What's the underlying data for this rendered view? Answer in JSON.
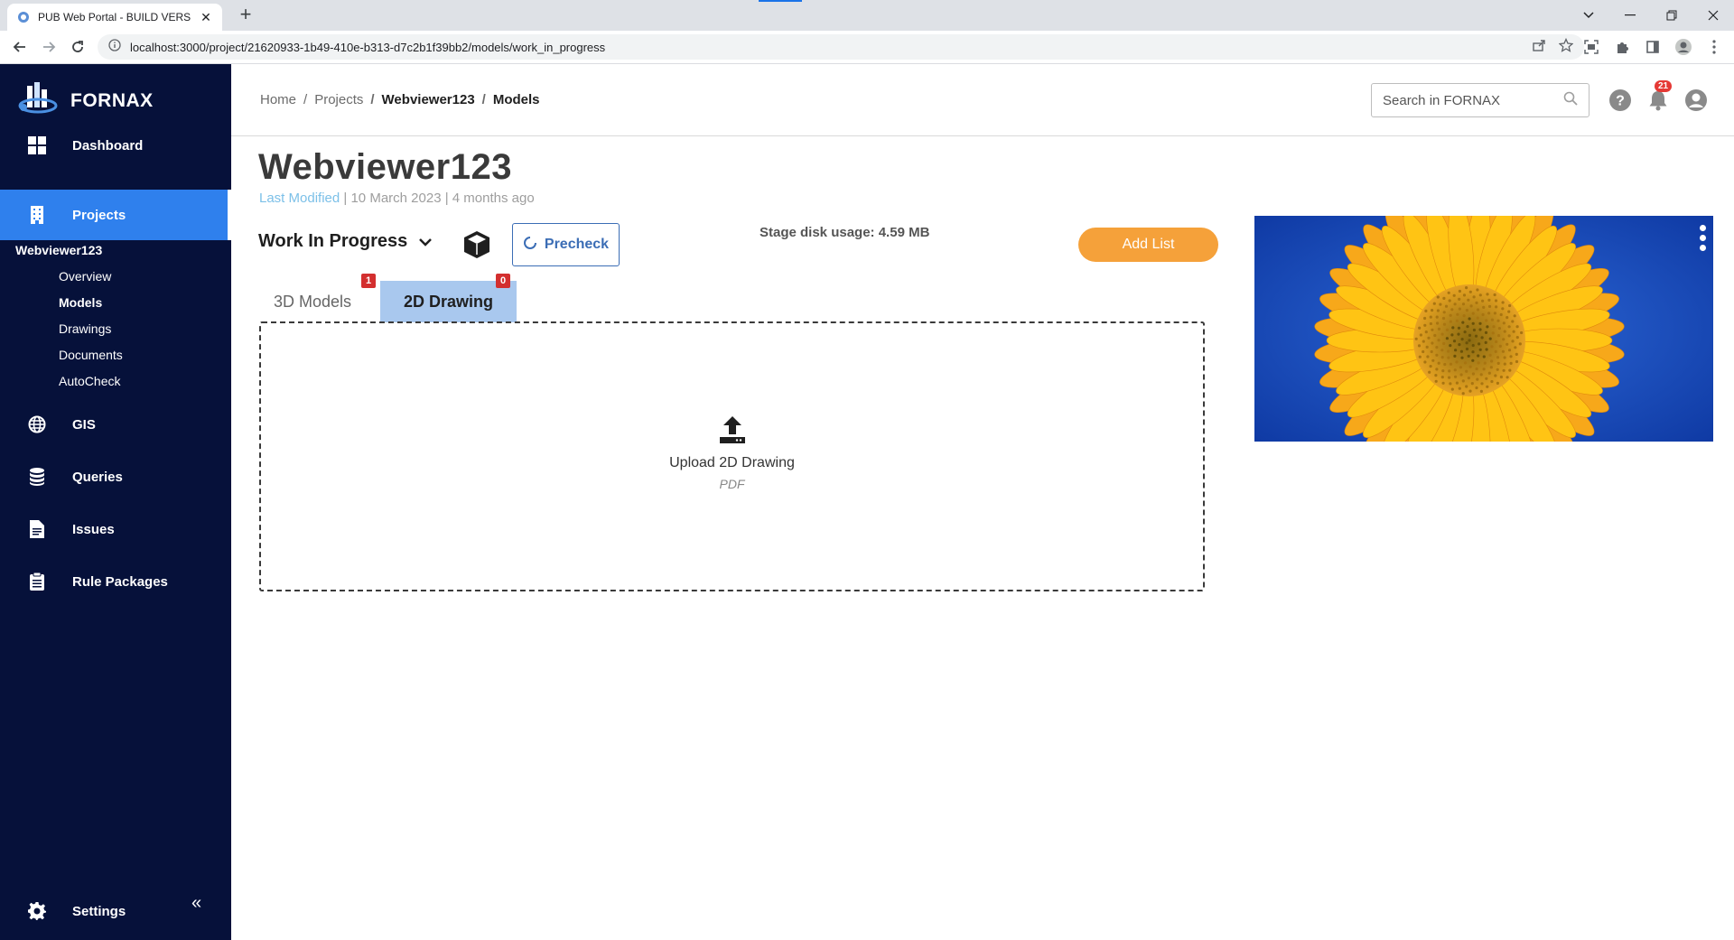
{
  "browser": {
    "tab_title": "PUB Web Portal - BUILD VERSION",
    "url": "localhost:3000/project/21620933-1b49-410e-b313-d7c2b1f39bb2/models/work_in_progress"
  },
  "sidebar": {
    "brand": "FORNAX",
    "items": [
      {
        "label": "Dashboard",
        "icon": "grid-icon"
      },
      {
        "label": "Projects",
        "icon": "building-icon",
        "active": true
      },
      {
        "label": "GIS",
        "icon": "globe-icon"
      },
      {
        "label": "Queries",
        "icon": "database-icon"
      },
      {
        "label": "Issues",
        "icon": "document-icon"
      },
      {
        "label": "Rule Packages",
        "icon": "clipboard-icon"
      }
    ],
    "project_name": "Webviewer123",
    "sub_items": [
      "Overview",
      "Models",
      "Drawings",
      "Documents",
      "AutoCheck"
    ],
    "active_sub_item": "Models",
    "settings_label": "Settings"
  },
  "header": {
    "breadcrumb": [
      "Home",
      "Projects",
      "Webviewer123",
      "Models"
    ],
    "search_placeholder": "Search in FORNAX",
    "notification_count": "21"
  },
  "project": {
    "title": "Webviewer123",
    "last_modified_label": "Last Modified",
    "last_modified_date": "10 March 2023",
    "relative_time": "4 months ago"
  },
  "toolbar": {
    "stage": "Work In Progress",
    "precheck_label": "Precheck",
    "disk_usage": "Stage disk usage: 4.59 MB",
    "add_list_label": "Add List"
  },
  "tabs": [
    {
      "label": "3D Models",
      "count": "1",
      "active": false
    },
    {
      "label": "2D Drawing",
      "count": "0",
      "active": true
    }
  ],
  "upload": {
    "label": "Upload 2D Drawing",
    "format": "PDF"
  },
  "colors": {
    "sidebar_bg": "#06113a",
    "active_nav": "#2f80ed",
    "accent_orange": "#f5a13a",
    "active_tab": "#a9c8ee",
    "badge_red": "#d32f2f"
  }
}
